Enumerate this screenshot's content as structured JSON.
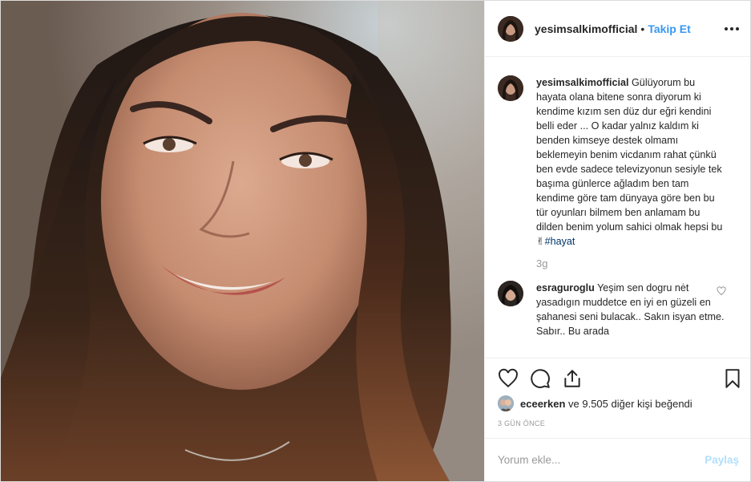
{
  "post": {
    "username": "yesimsalkimofficial",
    "dot": "•",
    "follow_label": "Takip Et",
    "caption": {
      "username": "yesimsalkimofficial",
      "text": "Gülüyorum bu hayata olana bitene sonra diyorum ki kendime kızım sen düz dur eğri kendini belli eder ... O kadar yalnız kaldım ki benden kimseye destek olmamı beklemeyin benim vicdanım rahat çünkü ben evde sadece televizyonun sesiyle tek başıma günlerce ağladım ben tam kendime göre tam dünyaya göre ben bu tür oyunları bilmem ben anlamam bu dilden benim yolum sahici olmak hepsi bu",
      "emoji": "✌",
      "hashtag": "#hayat",
      "time": "3g"
    },
    "comment": {
      "username": "esraguroglu",
      "text": "Yeşim sen dogru nėt yasadıgın muddetce en iyi en güzeli en şahanesi seni bulacak.. Sakın isyan etme. Sabır.. Bu arada"
    },
    "likes": {
      "user": "eceerken",
      "rest": "ve 9.505 diğer kişi beğendi"
    },
    "posted_ago": "3 GÜN ÖNCE",
    "add_comment": {
      "placeholder": "Yorum ekle...",
      "share_label": "Paylaş"
    },
    "colors": {
      "link": "#3897f0",
      "muted": "#999999",
      "share_disabled": "#b2dffc"
    },
    "icons": [
      "heart-icon",
      "comment-icon",
      "share-icon",
      "bookmark-icon",
      "more-icon"
    ]
  }
}
